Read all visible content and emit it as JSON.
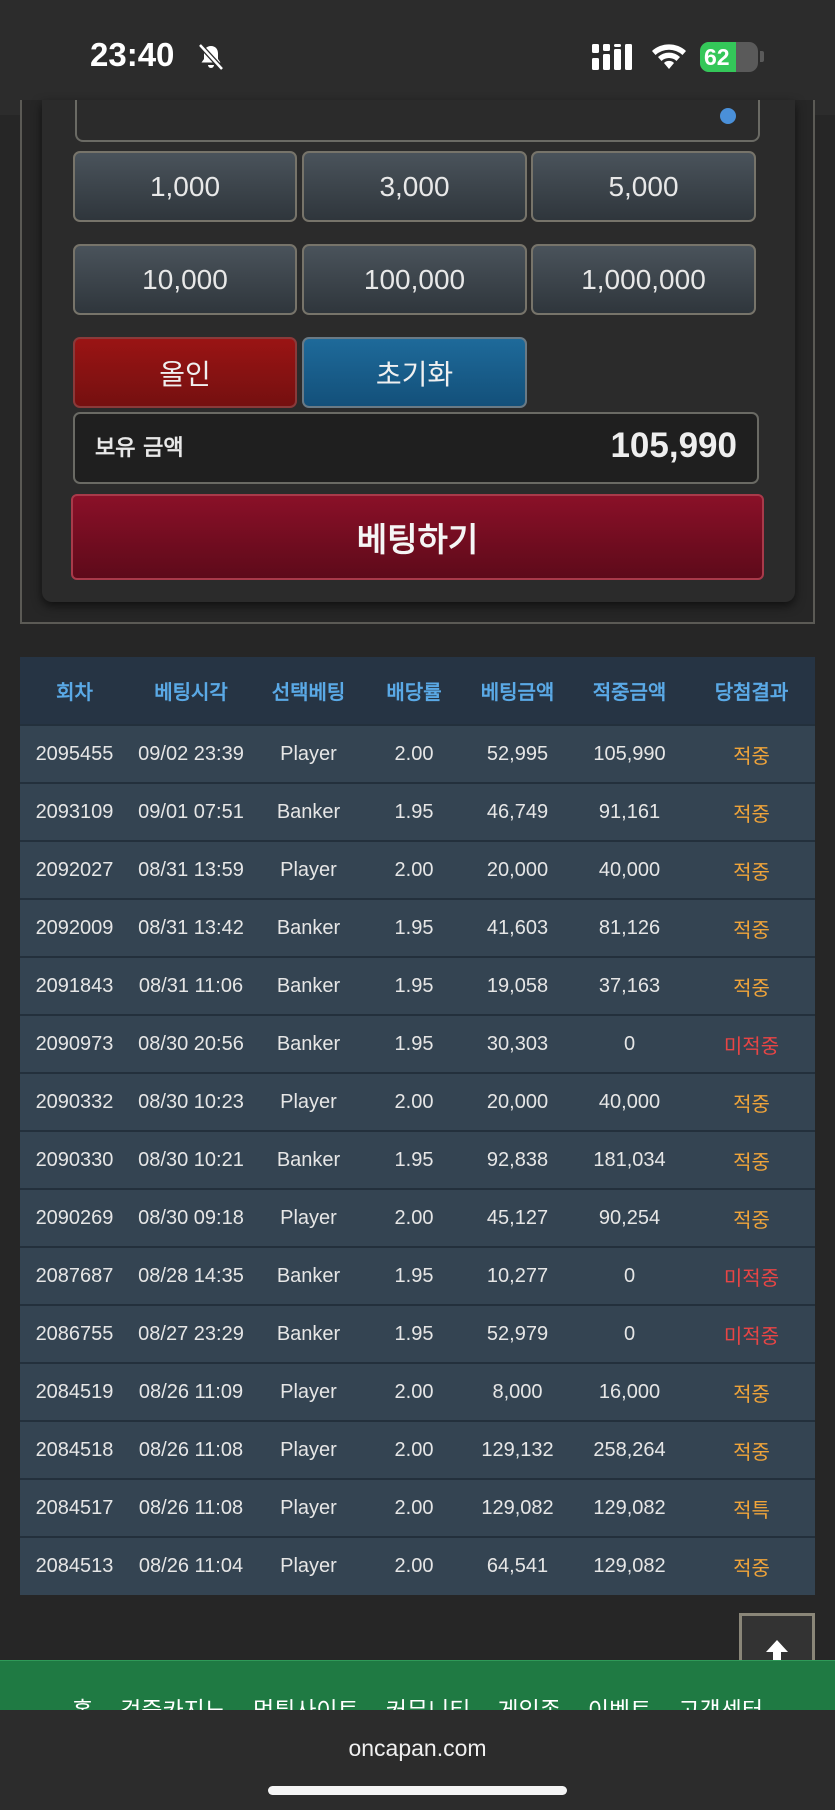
{
  "status_bar": {
    "time": "23:40",
    "battery": "62",
    "battery_level": 0.62,
    "icons": [
      "bell-slash-icon",
      "signal-icon",
      "wifi-icon",
      "battery-icon"
    ]
  },
  "bet_panel": {
    "chips": [
      "1,000",
      "3,000",
      "5,000",
      "10,000",
      "100,000",
      "1,000,000"
    ],
    "allin_label": "올인",
    "reset_label": "초기화",
    "balance_label": "보유 금액",
    "balance_value": "105,990",
    "bet_button_label": "베팅하기"
  },
  "history": {
    "headers": [
      "회차",
      "베팅시각",
      "선택베팅",
      "배당률",
      "베팅금액",
      "적중금액",
      "당첨결과"
    ],
    "rows": [
      [
        "2095455",
        "09/02 23:39",
        "Player",
        "2.00",
        "52,995",
        "105,990",
        "적중"
      ],
      [
        "2093109",
        "09/01 07:51",
        "Banker",
        "1.95",
        "46,749",
        "91,161",
        "적중"
      ],
      [
        "2092027",
        "08/31 13:59",
        "Player",
        "2.00",
        "20,000",
        "40,000",
        "적중"
      ],
      [
        "2092009",
        "08/31 13:42",
        "Banker",
        "1.95",
        "41,603",
        "81,126",
        "적중"
      ],
      [
        "2091843",
        "08/31 11:06",
        "Banker",
        "1.95",
        "19,058",
        "37,163",
        "적중"
      ],
      [
        "2090973",
        "08/30 20:56",
        "Banker",
        "1.95",
        "30,303",
        "0",
        "미적중"
      ],
      [
        "2090332",
        "08/30 10:23",
        "Player",
        "2.00",
        "20,000",
        "40,000",
        "적중"
      ],
      [
        "2090330",
        "08/30 10:21",
        "Banker",
        "1.95",
        "92,838",
        "181,034",
        "적중"
      ],
      [
        "2090269",
        "08/30 09:18",
        "Player",
        "2.00",
        "45,127",
        "90,254",
        "적중"
      ],
      [
        "2087687",
        "08/28 14:35",
        "Banker",
        "1.95",
        "10,277",
        "0",
        "미적중"
      ],
      [
        "2086755",
        "08/27 23:29",
        "Banker",
        "1.95",
        "52,979",
        "0",
        "미적중"
      ],
      [
        "2084519",
        "08/26 11:09",
        "Player",
        "2.00",
        "8,000",
        "16,000",
        "적중"
      ],
      [
        "2084518",
        "08/26 11:08",
        "Player",
        "2.00",
        "129,132",
        "258,264",
        "적중"
      ],
      [
        "2084517",
        "08/26 11:08",
        "Player",
        "2.00",
        "129,082",
        "129,082",
        "적특"
      ],
      [
        "2084513",
        "08/26 11:04",
        "Player",
        "2.00",
        "64,541",
        "129,082",
        "적중"
      ]
    ],
    "result_colors": {
      "hit": "#f0a43a",
      "miss": "#e84545"
    }
  },
  "footer_nav": [
    "홈",
    "검증카지노",
    "먹튀사이트",
    "커뮤니티",
    "게임존",
    "이벤트",
    "고객센터"
  ],
  "scroll_top_icon": "arrow-up-icon",
  "url_bar": {
    "url": "oncapan.com"
  },
  "colors": {
    "header_text": "#5aa9e6",
    "footer_bg": "#1f7a43",
    "bet_button": "#8a1028"
  }
}
